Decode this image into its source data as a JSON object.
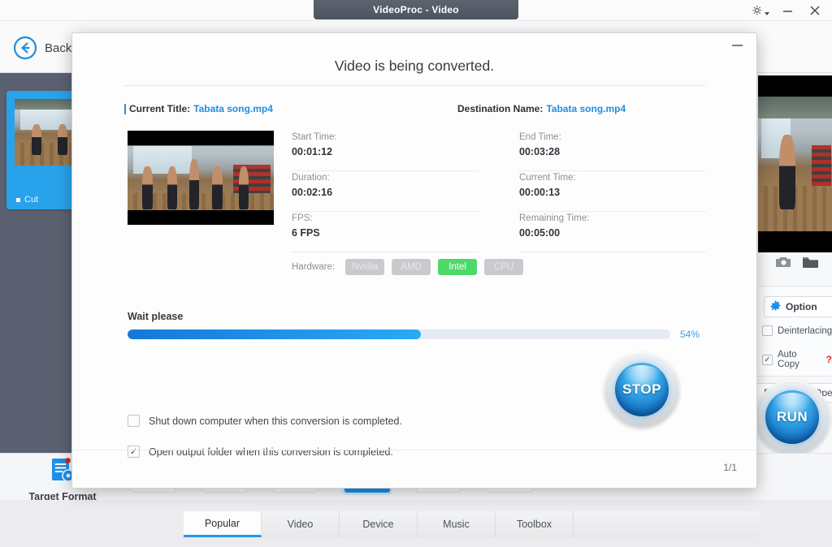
{
  "window": {
    "tab_title": "VideoProc - Video",
    "controls": {
      "settings": "gear-icon",
      "minimize": "minimize-icon",
      "close": "close-icon"
    }
  },
  "topbar": {
    "back_label": "Back",
    "back_icon": "back-circle-arrow-icon"
  },
  "workspace": {
    "media_card": {
      "cut_label": "Cut"
    }
  },
  "right_panel": {
    "snapshot_icon": "camera-icon",
    "folder_icon": "folder-icon",
    "option_label": "Option",
    "option_icon": "gear-icon",
    "deinterlacing_label": "Deinterlacing",
    "deinterlacing_checked": false,
    "auto_copy_label": "Auto Copy",
    "auto_copy_checked": true,
    "auto_copy_help": "?",
    "browse_label": "Browse",
    "open_label": "Open",
    "run_label": "RUN"
  },
  "format_strip": {
    "target_format_label": "Target Format",
    "target_format_icon": "document-gear-icon"
  },
  "bottom_tabs": {
    "items": [
      {
        "label": "Popular",
        "active": true
      },
      {
        "label": "Video",
        "active": false
      },
      {
        "label": "Device",
        "active": false
      },
      {
        "label": "Music",
        "active": false
      },
      {
        "label": "Toolbox",
        "active": false
      }
    ]
  },
  "dialog": {
    "title": "Video is being converted.",
    "minimize_icon": "minimize-icon",
    "current_title_label": "Current Title:",
    "current_title_value": "Tabata song.mp4",
    "destination_label": "Destination Name:",
    "destination_value": "Tabata song.mp4",
    "info": {
      "left": [
        {
          "key": "Start Time:",
          "value": "00:01:12"
        },
        {
          "key": "Duration:",
          "value": "00:02:16"
        },
        {
          "key": "FPS:",
          "value": "6 FPS"
        }
      ],
      "right": [
        {
          "key": "End Time:",
          "value": "00:03:28"
        },
        {
          "key": "Current Time:",
          "value": "00:00:13"
        },
        {
          "key": "Remaining Time:",
          "value": "00:05:00"
        }
      ]
    },
    "hardware": {
      "label": "Hardware:",
      "chips": [
        {
          "label": "Nvidia",
          "active": false
        },
        {
          "label": "AMD",
          "active": false
        },
        {
          "label": "Intel",
          "active": true
        },
        {
          "label": "CPU",
          "active": false
        }
      ],
      "active_color": "#4cd96a"
    },
    "progress": {
      "status_label": "Wait please",
      "percent_text": "54%",
      "percent_value": 54,
      "fill_from": "#1678d8",
      "fill_to": "#2aa9f6"
    },
    "options": [
      {
        "label": "Shut down computer when this conversion is completed.",
        "checked": false
      },
      {
        "label": "Open output folder when this conversion is completed.",
        "checked": true
      }
    ],
    "counter": "1/1",
    "stop_label": "STOP"
  }
}
